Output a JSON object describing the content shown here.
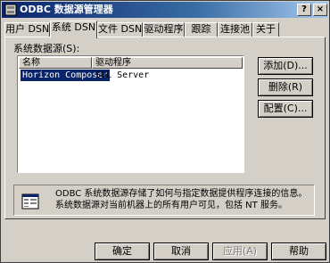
{
  "window": {
    "title": "ODBC 数据源管理器",
    "help_label": "?",
    "close_label": "×"
  },
  "tabs": [
    {
      "label": "用户 DSN",
      "active": false
    },
    {
      "label": "系统 DSN",
      "active": true
    },
    {
      "label": "文件 DSN",
      "active": false
    },
    {
      "label": "驱动程序",
      "active": false
    },
    {
      "label": "跟踪",
      "active": false
    },
    {
      "label": "连接池",
      "active": false
    },
    {
      "label": "关于",
      "active": false
    }
  ],
  "system_dsn": {
    "section_label": "系统数据源(S):",
    "columns": [
      "名称",
      "驱动程序"
    ],
    "rows": [
      {
        "name": "Horizon Composer",
        "driver": "SQL Server"
      }
    ]
  },
  "side_buttons": {
    "add": "添加(D)...",
    "remove": "删除(R)",
    "configure": "配置(C)..."
  },
  "info": {
    "text": "ODBC 系统数据源存储了如何与指定数据提供程序连接的信息。系统数据源对当前机器上的所有用户可见，包括 NT 服务。",
    "icon": "datasource-info-icon"
  },
  "bottom_buttons": {
    "ok": "确定",
    "cancel": "取消",
    "apply": "应用(A)",
    "help": "帮助"
  },
  "colors": {
    "titlebar": "#0a246a",
    "dialog": "#d4d0c8",
    "selection": "#0a246a"
  }
}
